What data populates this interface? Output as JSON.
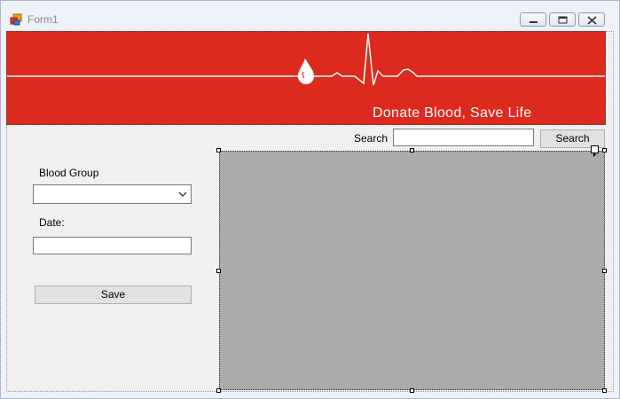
{
  "window": {
    "title": "Form1",
    "app_icon": "form-designer-icon",
    "controls": [
      "minimize-icon",
      "restore-icon",
      "close-icon"
    ]
  },
  "banner": {
    "slogan": "Donate Blood, Save Life",
    "background_color": "#dd2a1f",
    "graphic": "blood-drop-heartbeat-icon"
  },
  "form": {
    "blood_group_label": "Blood Group",
    "blood_group_value": "",
    "date_label": "Date:",
    "date_value": "",
    "save_label": "Save"
  },
  "search": {
    "label": "Search",
    "value": "",
    "button_label": "Search"
  },
  "grid": {
    "background_color": "#ababab",
    "rows": []
  }
}
